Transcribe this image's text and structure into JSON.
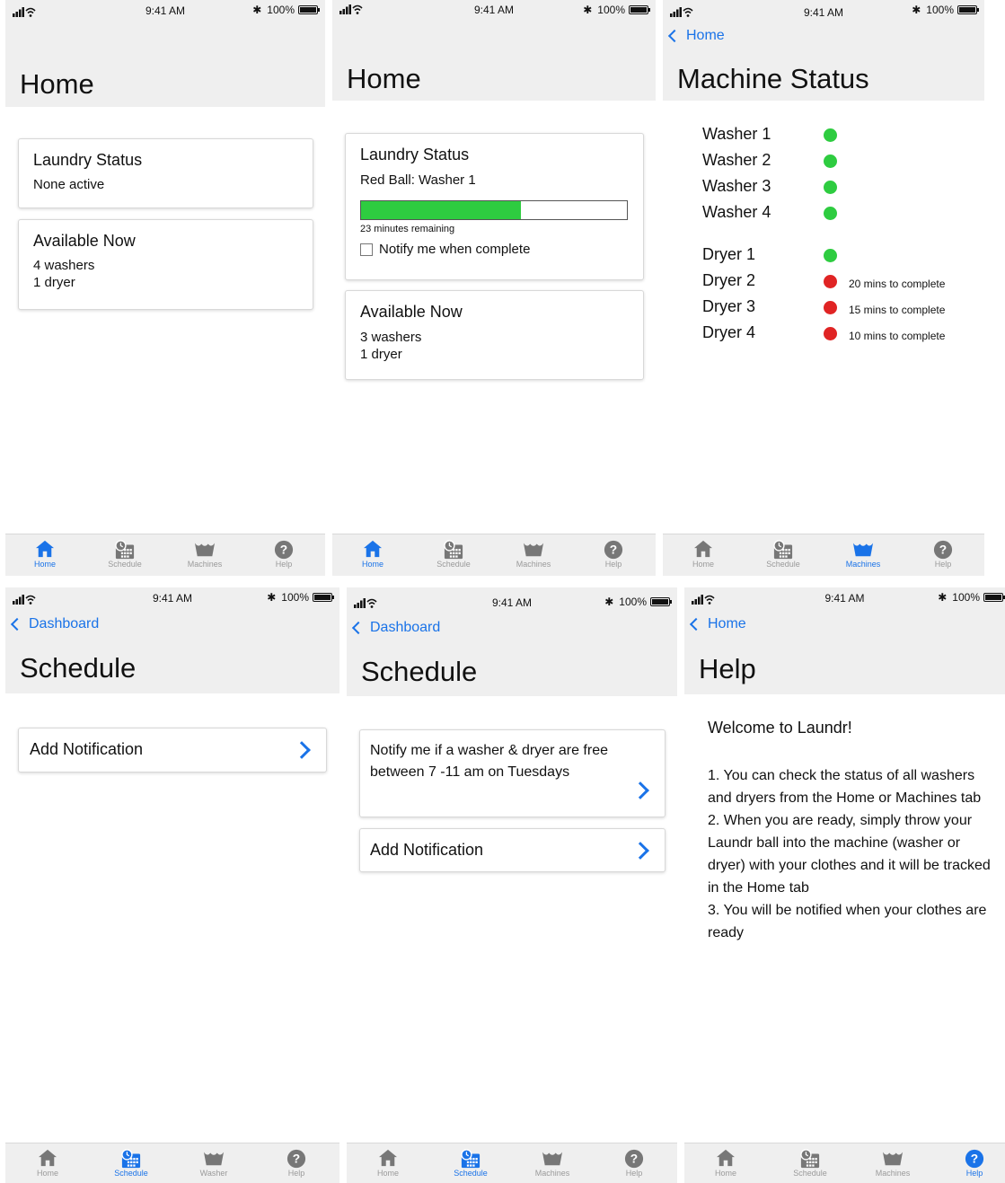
{
  "status_bar": {
    "time": "9:41 AM",
    "battery": "100%"
  },
  "colors": {
    "accent": "#1a73e8",
    "available": "#2ecc40",
    "busy": "#e02424",
    "header": "#efefef"
  },
  "icons": {
    "home": "home-icon",
    "schedule": "calendar-clock-icon",
    "machines": "washer-tub-icon",
    "help": "question-circle-icon"
  },
  "tabs": {
    "home": "Home",
    "schedule": "Schedule",
    "machines": "Machines",
    "washer": "Washer",
    "help": "Help"
  },
  "screen1": {
    "title": "Home",
    "laundry_title": "Laundry Status",
    "laundry_line": "None active",
    "available_title": "Available Now",
    "available_lines": [
      "4 washers",
      "1 dryer"
    ]
  },
  "screen2": {
    "title": "Home",
    "laundry_title": "Laundry Status",
    "laundry_line": "Red Ball: Washer 1",
    "progress": 0.6,
    "remaining": "23 minutes remaining",
    "notify_label": "Notify me when complete",
    "available_title": "Available Now",
    "available_lines": [
      "3 washers",
      "1 dryer"
    ]
  },
  "screen3": {
    "back": "Home",
    "title": "Machine Status",
    "washers": [
      {
        "name": "Washer 1",
        "status": "available",
        "note": ""
      },
      {
        "name": "Washer 2",
        "status": "available",
        "note": ""
      },
      {
        "name": "Washer 3",
        "status": "available",
        "note": ""
      },
      {
        "name": "Washer 4",
        "status": "available",
        "note": ""
      }
    ],
    "dryers": [
      {
        "name": "Dryer 1",
        "status": "available",
        "note": ""
      },
      {
        "name": "Dryer 2",
        "status": "busy",
        "note": "20 mins to complete"
      },
      {
        "name": "Dryer 3",
        "status": "busy",
        "note": "15 mins to complete"
      },
      {
        "name": "Dryer 4",
        "status": "busy",
        "note": "10 mins to complete"
      }
    ]
  },
  "screen4": {
    "back": "Dashboard",
    "title": "Schedule",
    "add_label": "Add Notification"
  },
  "screen5": {
    "back": "Dashboard",
    "title": "Schedule",
    "notification_lines": [
      "Notify me if a washer & dryer are free",
      "between 7 -11 am on Tuesdays"
    ],
    "add_label": "Add Notification"
  },
  "screen6": {
    "back": "Home",
    "title": "Help",
    "welcome": "Welcome to Laundr!",
    "paragraphs": [
      "1. You can check the status of all washers and dryers from the Home or Machines tab",
      "2. When you are ready, simply throw your Laundr ball into the machine (washer or dryer) with your clothes and it will be tracked in the Home tab",
      "3. You will be notified when your clothes are ready"
    ]
  }
}
